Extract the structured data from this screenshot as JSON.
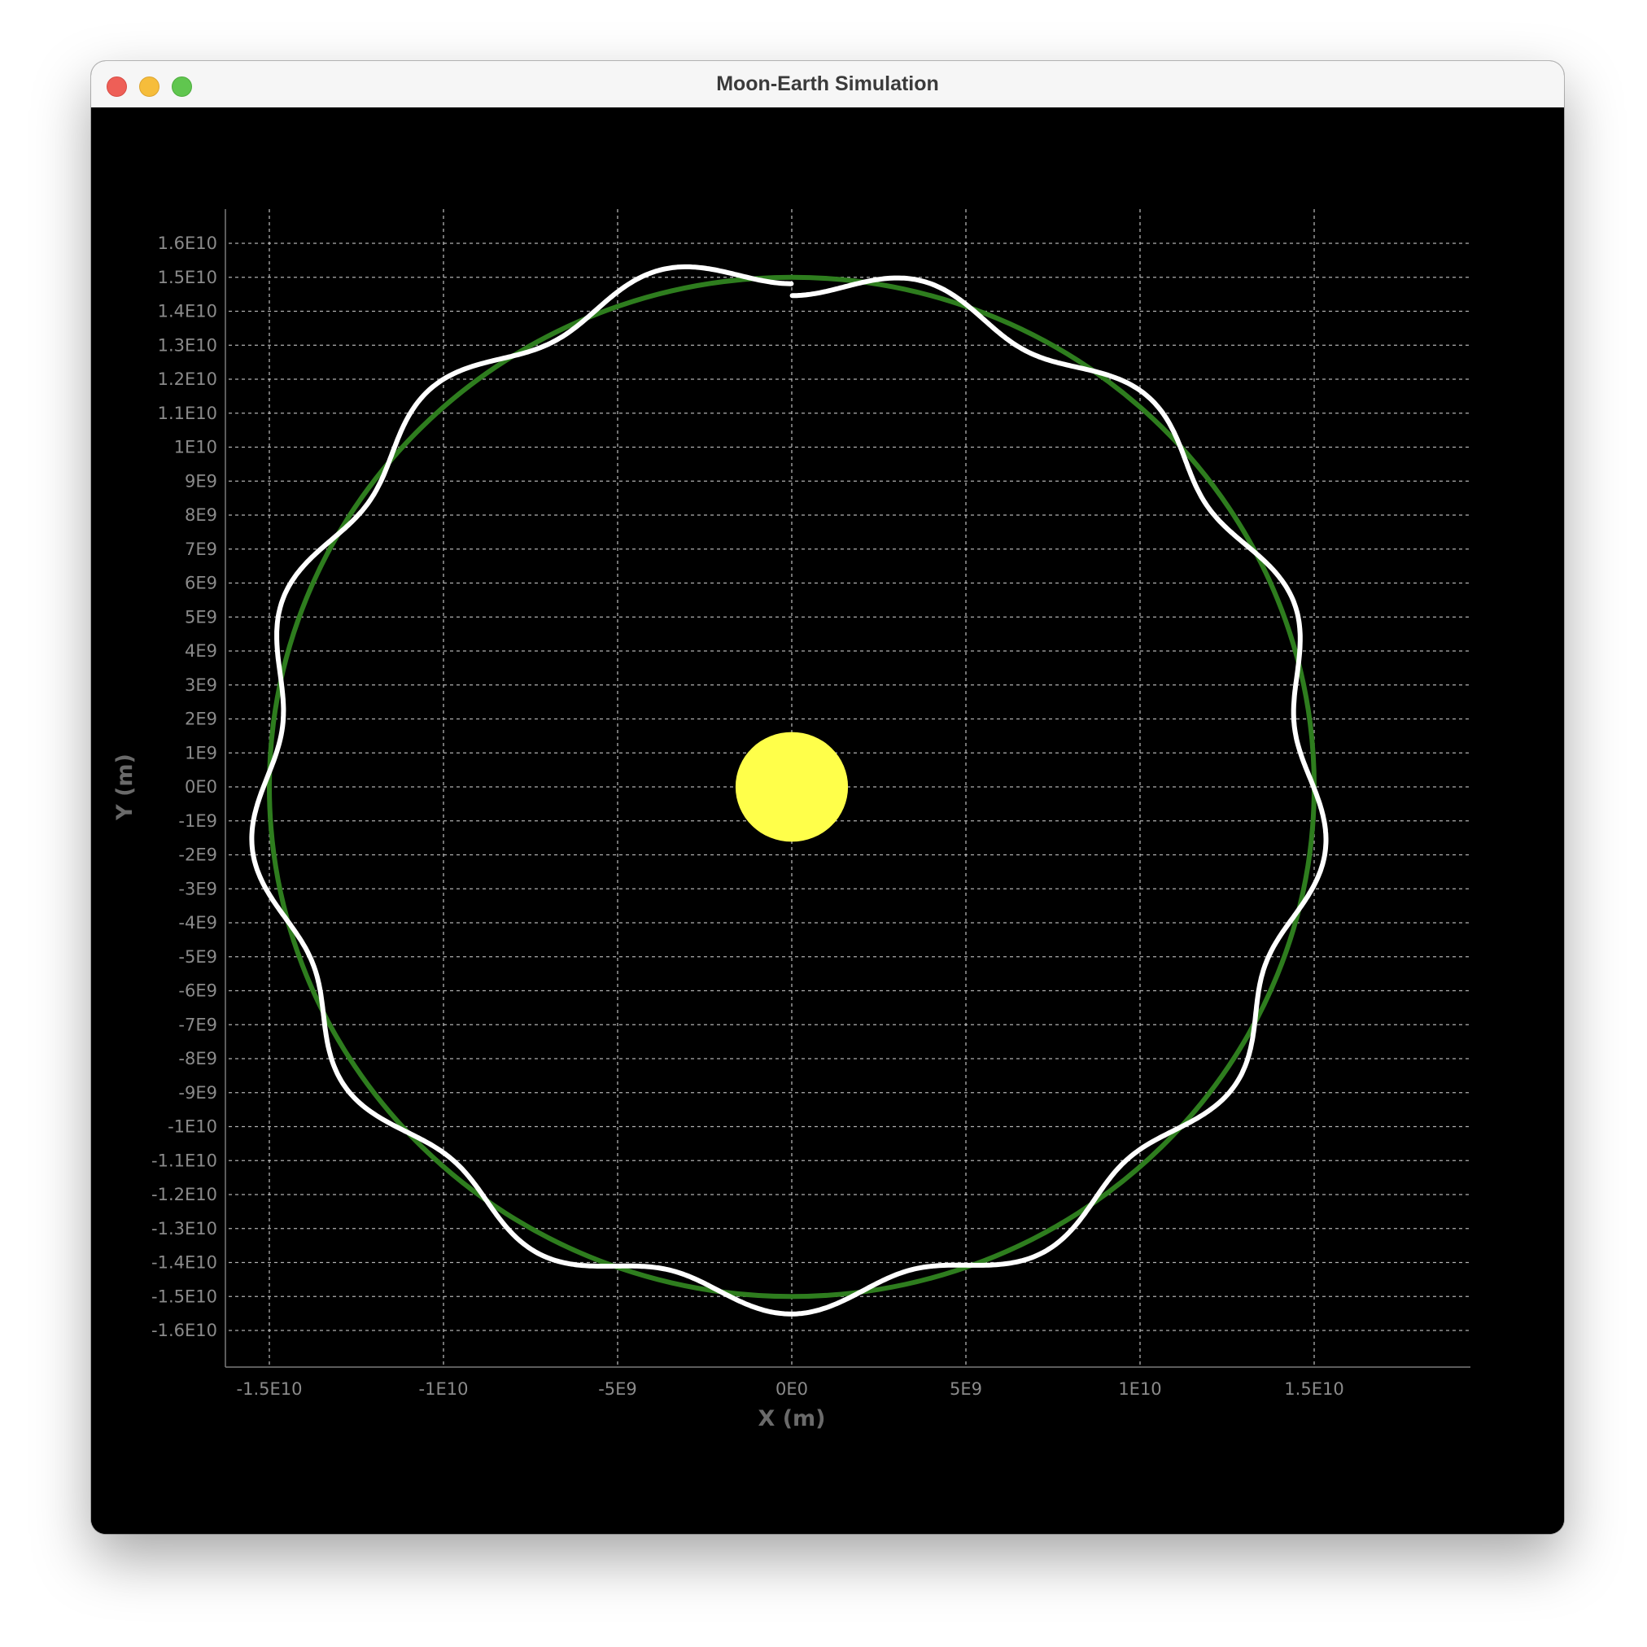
{
  "window": {
    "title": "Moon-Earth Simulation"
  },
  "colors": {
    "background": "#000000",
    "grid": "#d0d0d0",
    "earth_orbit": "#2e7d1e",
    "moon_path": "#ffffff",
    "sun": "#ffff4a"
  },
  "chart_data": {
    "type": "scatter",
    "title": "",
    "xlabel": "X (m)",
    "ylabel": "Y (m)",
    "xlim": [
      -17000000000.0,
      17000000000.0
    ],
    "ylim": [
      -17000000000.0,
      17000000000.0
    ],
    "grid": true,
    "x_ticks": [
      -15000000000.0,
      -10000000000.0,
      -5000000000.0,
      0,
      5000000000.0,
      10000000000.0,
      15000000000.0
    ],
    "x_tick_labels": [
      "-1.5E10",
      "-1E10",
      "-5E9",
      "0E0",
      "5E9",
      "1E10",
      "1.5E10"
    ],
    "y_ticks": [
      16000000000.0,
      15000000000.0,
      14000000000.0,
      13000000000.0,
      12000000000.0,
      11000000000.0,
      10000000000.0,
      9000000000.0,
      8000000000.0,
      7000000000.0,
      6000000000.0,
      5000000000.0,
      4000000000.0,
      3000000000.0,
      2000000000.0,
      1000000000.0,
      0,
      -1000000000.0,
      -2000000000.0,
      -3000000000.0,
      -4000000000.0,
      -5000000000.0,
      -6000000000.0,
      -7000000000.0,
      -8000000000.0,
      -9000000000.0,
      -10000000000.0,
      -11000000000.0,
      -12000000000.0,
      -13000000000.0,
      -14000000000.0,
      -15000000000.0,
      -16000000000.0
    ],
    "y_tick_labels": [
      "1.6E10",
      "1.5E10",
      "1.4E10",
      "1.3E10",
      "1.2E10",
      "1.1E10",
      "1E10",
      "9E9",
      "8E9",
      "7E9",
      "6E9",
      "5E9",
      "4E9",
      "3E9",
      "2E9",
      "1E9",
      "0E0",
      "-1E9",
      "-2E9",
      "-3E9",
      "-4E9",
      "-5E9",
      "-6E9",
      "-7E9",
      "-8E9",
      "-9E9",
      "-1E10",
      "-1.1E10",
      "-1.2E10",
      "-1.3E10",
      "-1.4E10",
      "-1.5E10",
      "-1.6E10"
    ],
    "sun": {
      "x": 0,
      "y": 0,
      "radius": 1700000000.0
    },
    "earth_orbit": {
      "center": [
        0,
        0
      ],
      "radius": 15000000000.0
    },
    "moon_path": {
      "mean_radius": 15000000000.0,
      "wobble_amplitude": 440000000.0,
      "wobble_cycles": 13,
      "start": [
        0,
        14900000000.0
      ],
      "end": [
        0,
        15400000000.0
      ]
    }
  }
}
